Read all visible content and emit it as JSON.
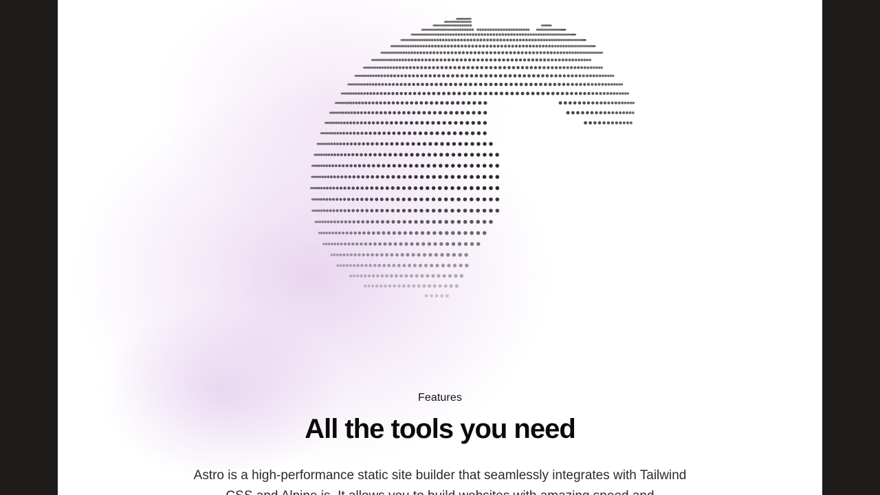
{
  "features_section": {
    "eyebrow": "Features",
    "headline": "All the tools you need",
    "description": "Astro is a high-performance static site builder that seamlessly integrates with Tailwind CSS and Alpine.js. It allows you to build websites with amazing speed and"
  },
  "globe": {
    "icon": "dotted-globe-illustration",
    "dot_color": "#2a2a2a",
    "glow_color": "#d9bce6"
  },
  "theme": {
    "frame_background": "#ffffff",
    "outer_background": "#1f1d1b",
    "text_color": "#0a0a0a"
  }
}
